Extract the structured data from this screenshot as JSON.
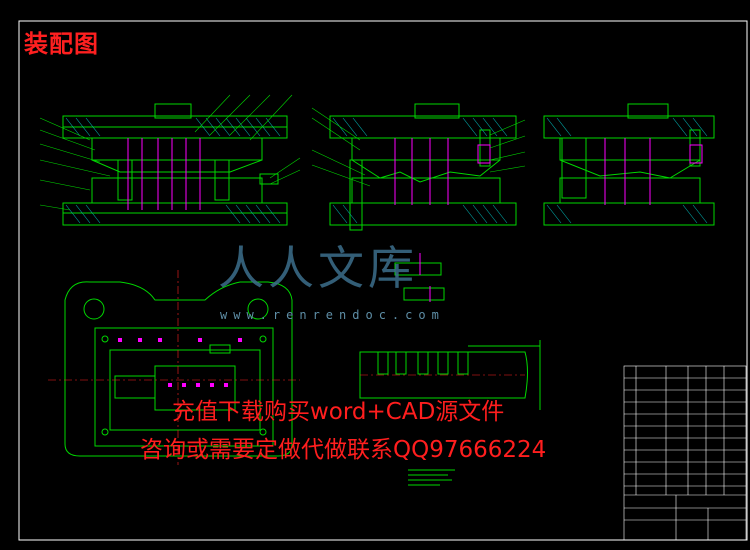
{
  "title": "装配图",
  "watermark": {
    "logo_text": "人人文库",
    "url_text": "www.renrendoc.com"
  },
  "overlay": {
    "line1": "充值下载购买word+CAD源文件",
    "line2": "咨询或需要定做代做联系QQ97666224"
  },
  "colors": {
    "background": "#000000",
    "frame": "#ffffff",
    "green": "#00d800",
    "cyan": "#00c8c8",
    "magenta": "#ff00ff",
    "red": "#ff2020",
    "yellow": "#e0e000"
  }
}
